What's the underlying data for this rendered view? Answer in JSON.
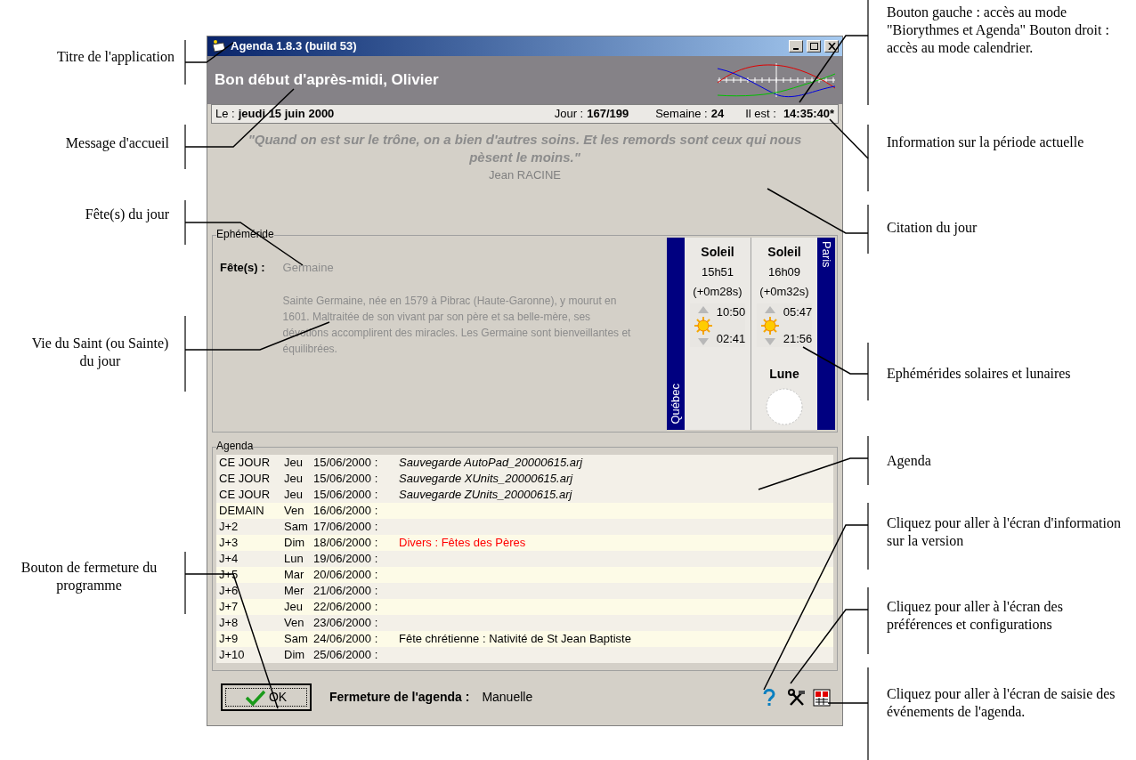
{
  "window": {
    "title": "Agenda 1.8.3 (build 53)"
  },
  "greeting": "Bon début d'après-midi, Olivier",
  "info_bar": {
    "date_label": "Le :",
    "date": "jeudi 15 juin 2000",
    "day_label": "Jour :",
    "day": "167/199",
    "week_label": "Semaine :",
    "week": "24",
    "time_label": "Il est :",
    "time": "14:35:40*"
  },
  "quote": {
    "text": "\"Quand on est sur le trône, on a bien d'autres soins. Et les remords sont ceux qui nous pèsent le moins.\"",
    "author": "Jean RACINE"
  },
  "ephemeride": {
    "title": "Ephéméride",
    "feasts_label": "Fête(s) :",
    "feasts": "Germaine",
    "life": "Sainte Germaine, née en 1579 à Pibrac (Haute-Garonne), y mourut en 1601. Maltraitée de son vivant par son père et sa belle-mère, ses dévotions accomplirent des miracles. Les Germaine sont bienveillantes et équilibrées.",
    "cities": [
      {
        "name": "Québec",
        "sun_label": "Soleil",
        "day_length": "15h51",
        "delta": "(+0m28s)",
        "sunrise": "10:50",
        "sunset": "02:41"
      },
      {
        "name": "Paris",
        "sun_label": "Soleil",
        "day_length": "16h09",
        "delta": "(+0m32s)",
        "sunrise": "05:47",
        "sunset": "21:56"
      }
    ],
    "moon_label": "Lune"
  },
  "agenda": {
    "title": "Agenda",
    "rows": [
      {
        "when": "CE JOUR",
        "day": "Jeu",
        "date": "15/06/2000 :",
        "event": "Sauvegarde AutoPad_20000615.arj",
        "kind": "backup"
      },
      {
        "when": "CE JOUR",
        "day": "Jeu",
        "date": "15/06/2000 :",
        "event": "Sauvegarde XUnits_20000615.arj",
        "kind": "backup"
      },
      {
        "when": "CE JOUR",
        "day": "Jeu",
        "date": "15/06/2000 :",
        "event": "Sauvegarde ZUnits_20000615.arj",
        "kind": "backup"
      },
      {
        "when": "DEMAIN",
        "day": "Ven",
        "date": "16/06/2000 :"
      },
      {
        "when": "J+2",
        "day": "Sam",
        "date": "17/06/2000 :"
      },
      {
        "when": "J+3",
        "day": "Dim",
        "date": "18/06/2000 :",
        "event": "Divers : Fêtes des Pères",
        "kind": "misc"
      },
      {
        "when": "J+4",
        "day": "Lun",
        "date": "19/06/2000 :"
      },
      {
        "when": "J+5",
        "day": "Mar",
        "date": "20/06/2000 :"
      },
      {
        "when": "J+6",
        "day": "Mer",
        "date": "21/06/2000 :"
      },
      {
        "when": "J+7",
        "day": "Jeu",
        "date": "22/06/2000 :"
      },
      {
        "when": "J+8",
        "day": "Ven",
        "date": "23/06/2000 :"
      },
      {
        "when": "J+9",
        "day": "Sam",
        "date": "24/06/2000 :",
        "event": "Fête chrétienne : Nativité de St Jean Baptiste",
        "kind": "feast"
      },
      {
        "when": "J+10",
        "day": "Dim",
        "date": "25/06/2000 :"
      }
    ]
  },
  "footer": {
    "ok_button": "OK",
    "closing_label": "Fermeture de l'agenda :",
    "closing_value": "Manuelle"
  },
  "annotations": [
    {
      "text": "Titre de l'application"
    },
    {
      "text": "Message d'accueil"
    },
    {
      "text": "Fête(s) du jour"
    },
    {
      "text": "Vie du Saint (ou Sainte) du jour"
    },
    {
      "text": "Bouton de fermeture du programme"
    },
    {
      "text": "Bouton gauche : accès au mode \"Biorythmes et Agenda\" Bouton droit : accès au mode calendrier."
    },
    {
      "text": "Information sur la période actuelle"
    },
    {
      "text": "Citation du jour"
    },
    {
      "text": "Ephémérides solaires et lunaires"
    },
    {
      "text": "Agenda"
    },
    {
      "text": "Cliquez pour aller à l'écran d'information sur la version"
    },
    {
      "text": "Cliquez pour aller à l'écran des préférences et configurations"
    },
    {
      "text": "Cliquez pour aller à l'écran de saisie des événements de l'agenda."
    }
  ]
}
